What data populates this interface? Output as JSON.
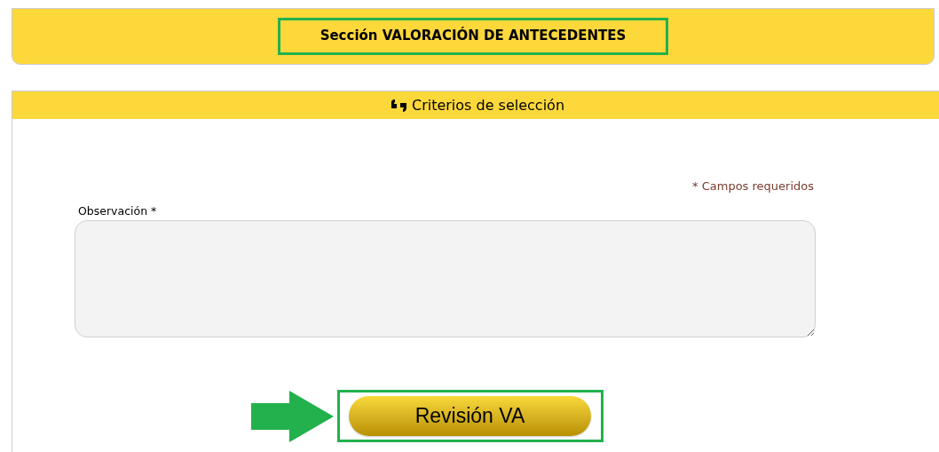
{
  "section_header": {
    "title": "Sección VALORACIÓN DE ANTECEDENTES"
  },
  "panel": {
    "title": "Criterios de selección",
    "required_note": "* Campos requeridos",
    "field": {
      "label": "Observación",
      "required_mark": "*"
    },
    "button": "Revisión VA"
  }
}
